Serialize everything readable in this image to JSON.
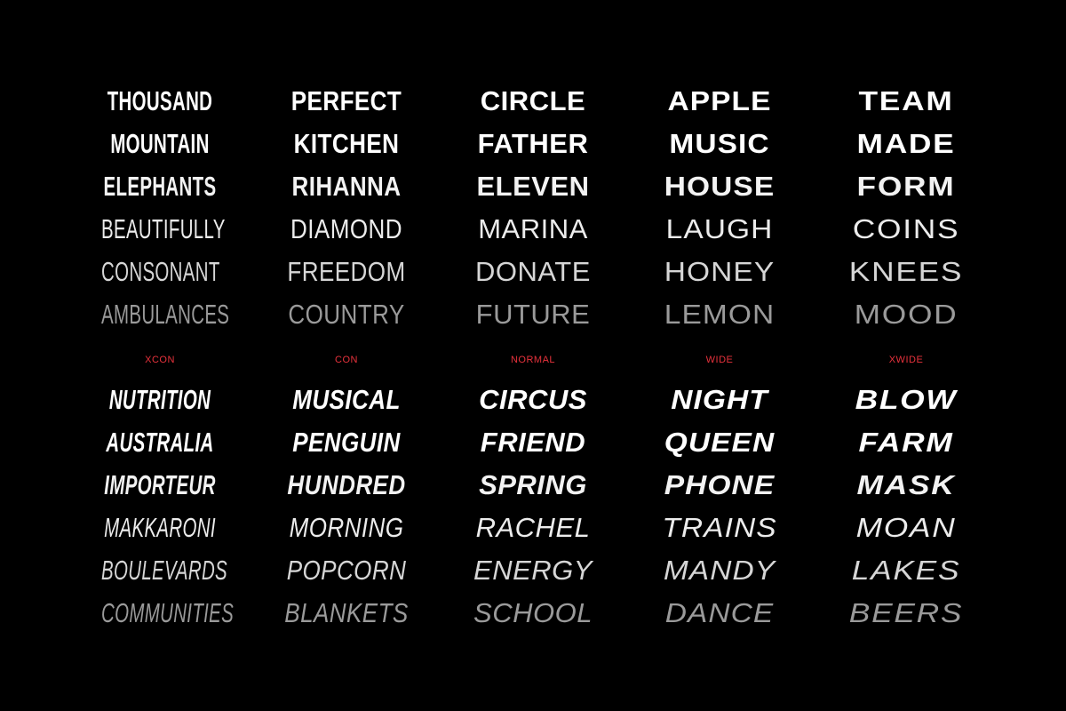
{
  "colors": {
    "background": "#000000",
    "text": "#ffffff",
    "label": "#e8323c"
  },
  "columns": [
    {
      "label": "XCON",
      "upright": [
        "THOUSAND",
        "MOUNTAIN",
        "ELEPHANTS",
        "BEAUTIFULLY",
        "CONSONANT",
        "AMBULANCES"
      ],
      "italic": [
        "NUTRITION",
        "AUSTRALIA",
        "IMPORTEUR",
        "MAKKARONI",
        "BOULEVARDS",
        "COMMUNITIES"
      ]
    },
    {
      "label": "CON",
      "upright": [
        "PERFECT",
        "KITCHEN",
        "RIHANNA",
        "DIAMOND",
        "FREEDOM",
        "COUNTRY"
      ],
      "italic": [
        "MUSICAL",
        "PENGUIN",
        "HUNDRED",
        "MORNING",
        "POPCORN",
        "BLANKETS"
      ]
    },
    {
      "label": "NORMAL",
      "upright": [
        "CIRCLE",
        "FATHER",
        "ELEVEN",
        "MARINA",
        "DONATE",
        "FUTURE"
      ],
      "italic": [
        "CIRCUS",
        "FRIEND",
        "SPRING",
        "RACHEL",
        "ENERGY",
        "SCHOOL"
      ]
    },
    {
      "label": "WIDE",
      "upright": [
        "APPLE",
        "MUSIC",
        "HOUSE",
        "LAUGH",
        "HONEY",
        "LEMON"
      ],
      "italic": [
        "NIGHT",
        "QUEEN",
        "PHONE",
        "TRAINS",
        "MANDY",
        "DANCE"
      ]
    },
    {
      "label": "XWIDE",
      "upright": [
        "TEAM",
        "MADE",
        "FORM",
        "COINS",
        "KNEES",
        "MOOD"
      ],
      "italic": [
        "BLOW",
        "FARM",
        "MASK",
        "MOAN",
        "LAKES",
        "BEERS"
      ]
    }
  ]
}
